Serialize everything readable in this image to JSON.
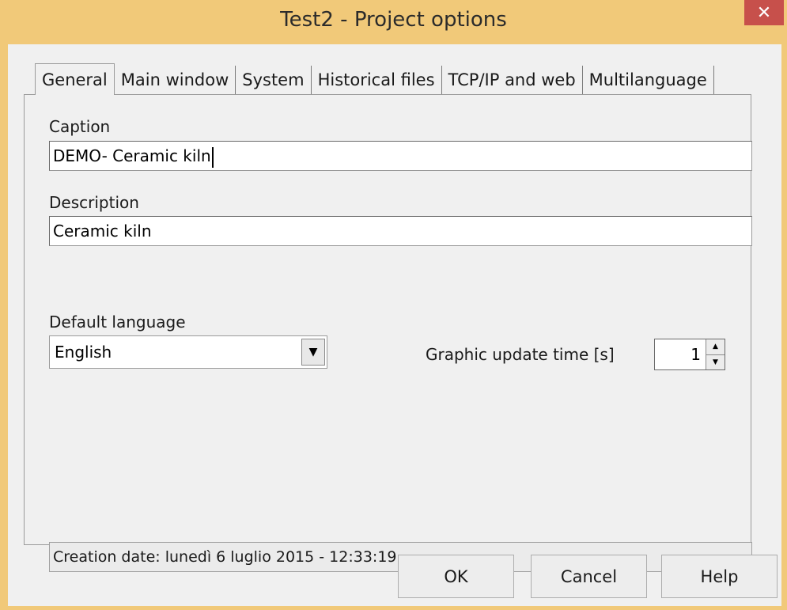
{
  "window": {
    "title": "Test2 - Project options",
    "close_glyph": "✕"
  },
  "tabs": [
    {
      "label": "General",
      "active": true
    },
    {
      "label": "Main window",
      "active": false
    },
    {
      "label": "System",
      "active": false
    },
    {
      "label": "Historical files",
      "active": false
    },
    {
      "label": "TCP/IP and web",
      "active": false
    },
    {
      "label": "Multilanguage",
      "active": false
    }
  ],
  "general": {
    "caption_label": "Caption",
    "caption_value": "DEMO- Ceramic kiln",
    "description_label": "Description",
    "description_value": "Ceramic kiln",
    "language_label": "Default language",
    "language_value": "English",
    "update_time_label": "Graphic update time [s]",
    "update_time_value": "1",
    "creation_date": "Creation date: lunedì 6 luglio 2015 - 12:33:19"
  },
  "buttons": {
    "ok": "OK",
    "cancel": "Cancel",
    "help": "Help"
  },
  "icons": {
    "dropdown": "chevron-down-icon",
    "spin_up": "arrow-up-icon",
    "spin_down": "arrow-down-icon"
  },
  "colors": {
    "titlebar": "#f1c979",
    "close_button": "#c7504b",
    "dialog_background": "#f0f0f0"
  }
}
